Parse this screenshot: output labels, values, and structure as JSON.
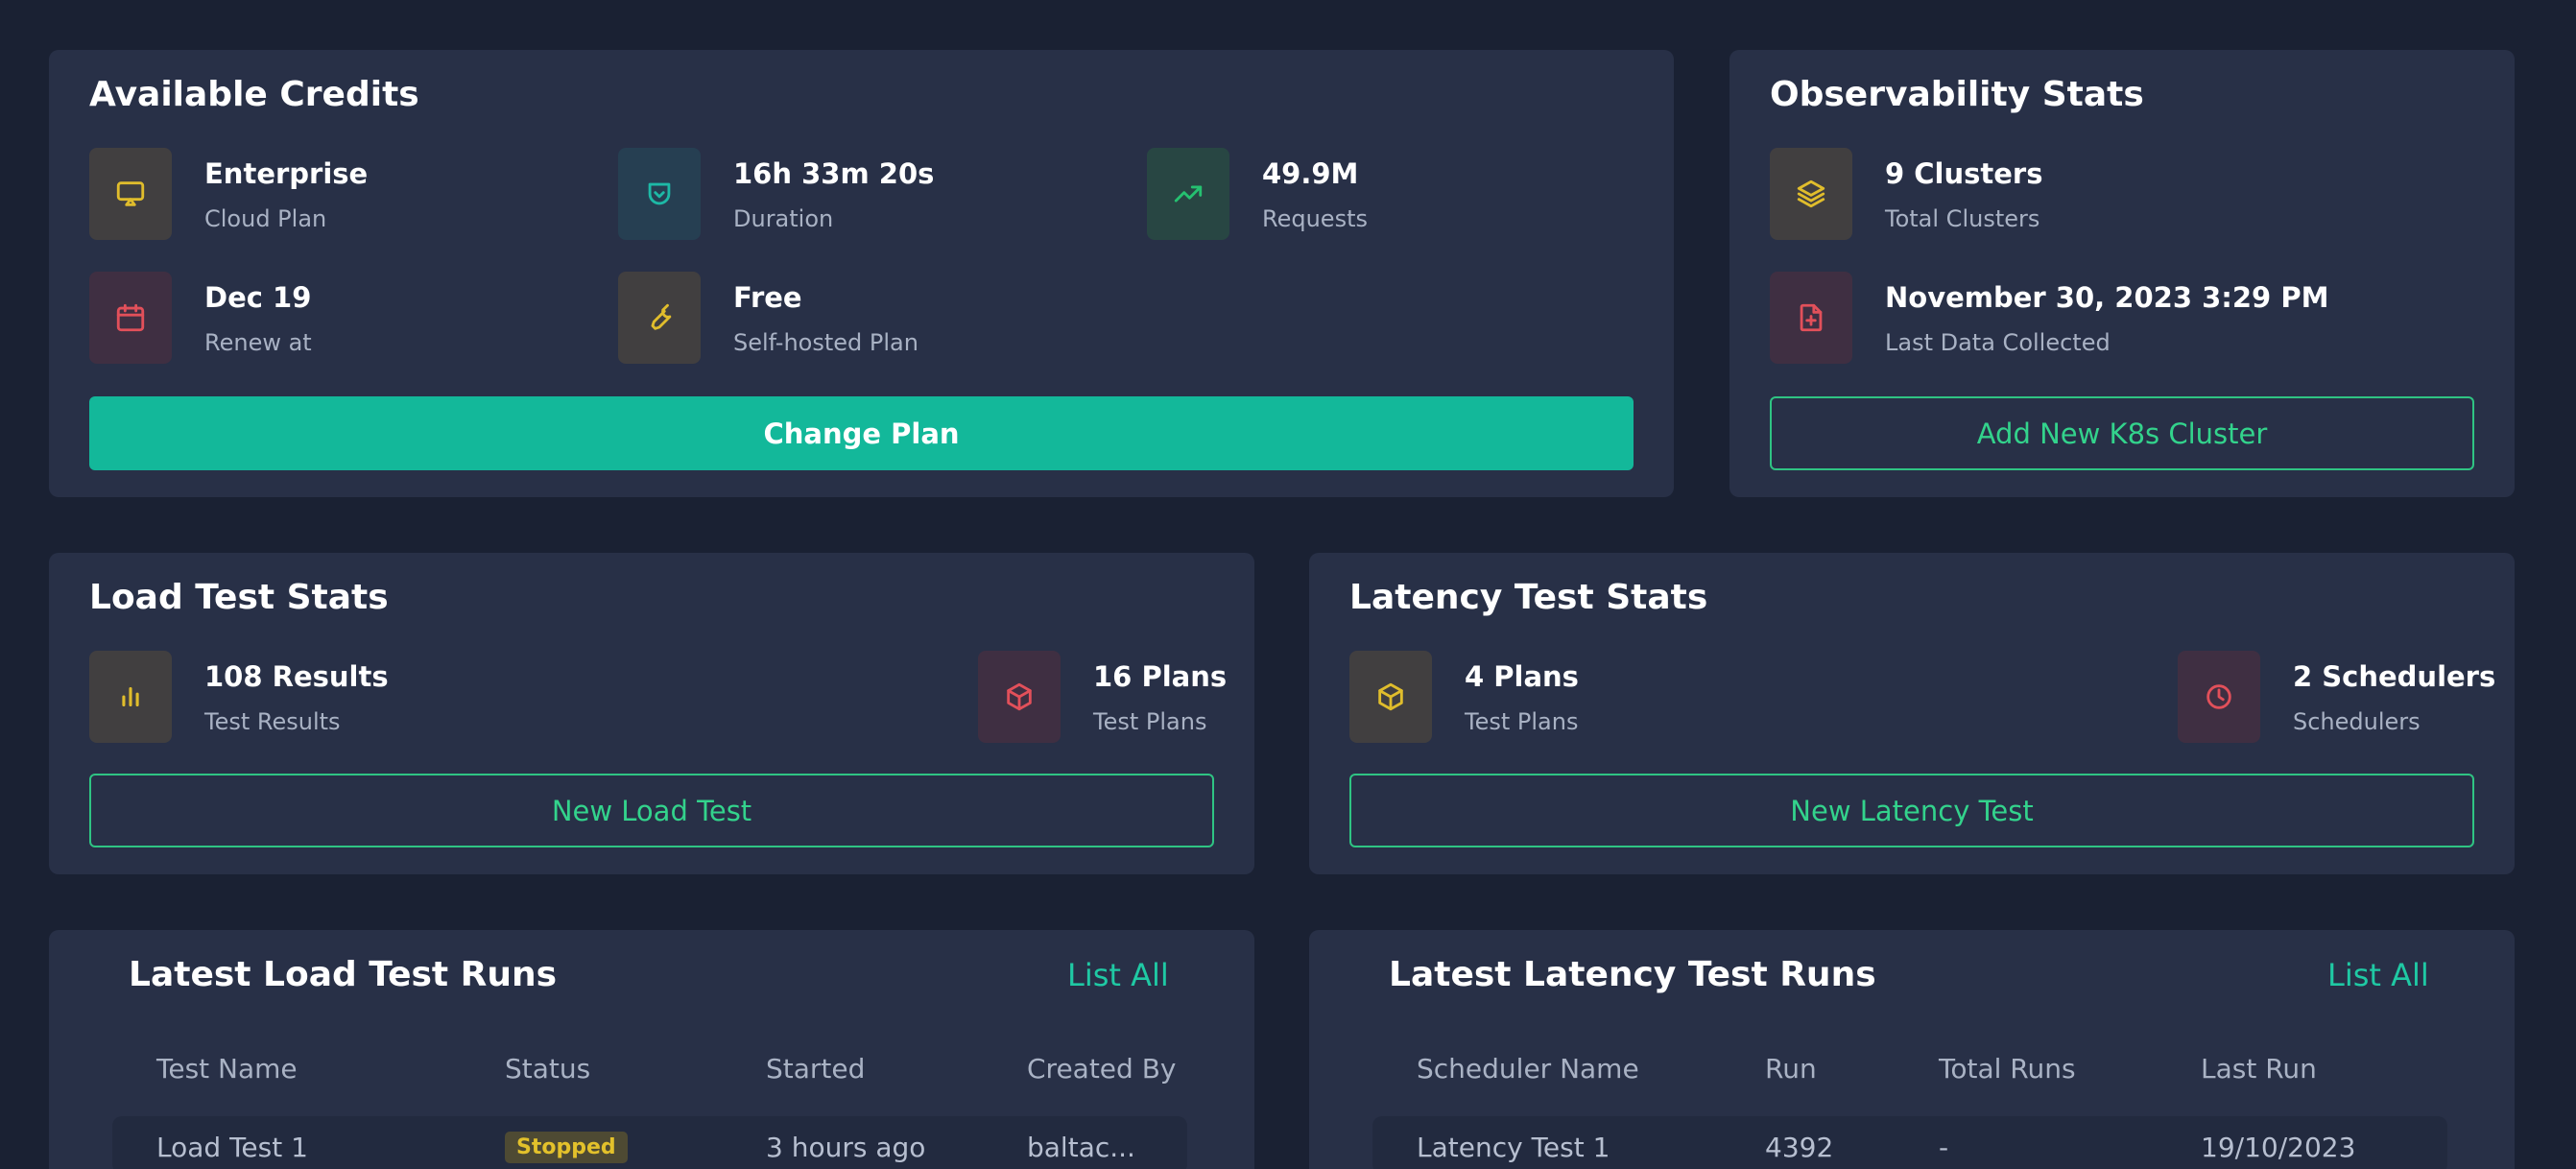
{
  "credits": {
    "title": "Available Credits",
    "stats": [
      {
        "value": "Enterprise",
        "label": "Cloud Plan",
        "icon": "monitor-icon"
      },
      {
        "value": "16h 33m 20s",
        "label": "Duration",
        "icon": "shield-check-icon"
      },
      {
        "value": "49.9M",
        "label": "Requests",
        "icon": "trending-up-icon"
      },
      {
        "value": "Dec 19",
        "label": "Renew at",
        "icon": "calendar-icon"
      },
      {
        "value": "Free",
        "label": "Self-hosted Plan",
        "icon": "wrench-icon"
      }
    ],
    "button": "Change Plan"
  },
  "observability": {
    "title": "Observability Stats",
    "stats": [
      {
        "value": "9 Clusters",
        "label": "Total Clusters",
        "icon": "layers-icon"
      },
      {
        "value": "November 30, 2023 3:29 PM",
        "label": "Last Data Collected",
        "icon": "file-plus-icon"
      }
    ],
    "button": "Add New K8s Cluster"
  },
  "load_stats": {
    "title": "Load Test Stats",
    "stats": [
      {
        "value": "108 Results",
        "label": "Test Results",
        "icon": "bar-chart-icon"
      },
      {
        "value": "16 Plans",
        "label": "Test Plans",
        "icon": "box-icon"
      }
    ],
    "button": "New Load Test"
  },
  "latency_stats": {
    "title": "Latency Test Stats",
    "stats": [
      {
        "value": "4 Plans",
        "label": "Test Plans",
        "icon": "box-icon"
      },
      {
        "value": "2 Schedulers",
        "label": "Schedulers",
        "icon": "clock-icon"
      }
    ],
    "button": "New Latency Test"
  },
  "load_runs": {
    "title": "Latest Load Test Runs",
    "list_all": "List All",
    "columns": [
      "Test Name",
      "Status",
      "Started",
      "Created By"
    ],
    "rows": [
      {
        "name": "Load Test 1",
        "status": "Stopped",
        "started": "3 hours ago",
        "created_by": "baltac..."
      }
    ]
  },
  "latency_runs": {
    "title": "Latest Latency Test Runs",
    "list_all": "List All",
    "columns": [
      "Scheduler Name",
      "Run",
      "Total Runs",
      "Last Run"
    ],
    "rows": [
      {
        "name": "Latency Test 1",
        "run": "4392",
        "total_runs": "-",
        "last_run": "19/10/2023"
      }
    ]
  },
  "colors": {
    "accent": "#13b89a",
    "outline_green": "#2fc483",
    "status_stopped": "#e3c12b",
    "icon_yellow": "#e0bd2c",
    "icon_red": "#e2505a",
    "icon_green": "#25c170",
    "icon_teal": "#1db9a6"
  }
}
